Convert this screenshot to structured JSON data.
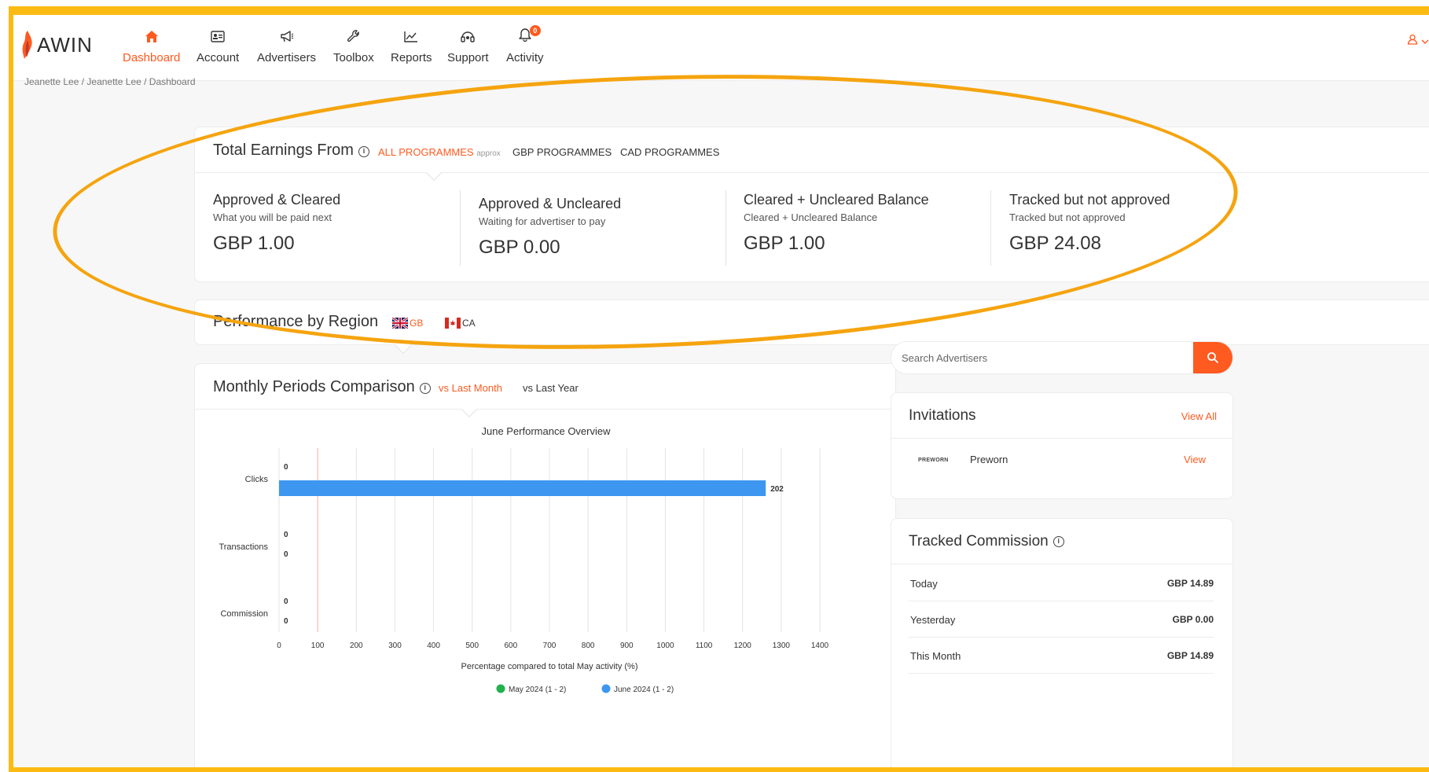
{
  "app": {
    "logo_text": "AWIN"
  },
  "nav": {
    "items": [
      {
        "label": "Dashboard",
        "icon": "home-icon"
      },
      {
        "label": "Account",
        "icon": "id-card-icon"
      },
      {
        "label": "Advertisers",
        "icon": "megaphone-icon"
      },
      {
        "label": "Toolbox",
        "icon": "wrench-icon"
      },
      {
        "label": "Reports",
        "icon": "chart-line-icon"
      },
      {
        "label": "Support",
        "icon": "headset-icon"
      },
      {
        "label": "Activity",
        "icon": "bell-icon"
      }
    ],
    "activity_badge": "0",
    "accent_color": "#ff5a1f"
  },
  "breadcrumb": "Jeanette Lee / Jeanette Lee / Dashboard",
  "earnings": {
    "title": "Total Earnings From",
    "tabs": {
      "all": "ALL PROGRAMMES",
      "all_note": "approx",
      "gbp": "GBP PROGRAMMES",
      "cad": "CAD PROGRAMMES"
    },
    "cols": [
      {
        "label": "Approved & Cleared",
        "sub": "What you will be paid next",
        "amount": "GBP 1.00"
      },
      {
        "label": "Approved & Uncleared",
        "sub": "Waiting for advertiser to pay",
        "amount": "GBP 0.00"
      },
      {
        "label": "Cleared + Uncleared Balance",
        "sub": "Cleared + Uncleared Balance",
        "amount": "GBP 1.00"
      },
      {
        "label": "Tracked but not approved",
        "sub": "Tracked but not approved",
        "amount": "GBP 24.08"
      }
    ]
  },
  "region": {
    "title": "Performance by Region",
    "gb": "GB",
    "ca": "CA"
  },
  "monthly": {
    "title": "Monthly Periods Comparison",
    "tab_last_month": "vs Last Month",
    "tab_last_year": "vs Last Year"
  },
  "chart_data": {
    "type": "bar",
    "orientation": "horizontal",
    "title": "June Performance Overview",
    "xlabel": "Percentage compared to total May activity (%)",
    "categories": [
      "Clicks",
      "Transactions",
      "Commission"
    ],
    "series": [
      {
        "name": "May 2024 (1 - 2)",
        "color": "#22b14c",
        "values": [
          0,
          0,
          0
        ]
      },
      {
        "name": "June 2024 (1 - 2)",
        "color": "#3d97f0",
        "values": [
          202,
          0,
          0
        ]
      }
    ],
    "bar_extent_percent": 1260,
    "xlim": [
      0,
      1400
    ],
    "xticks": [
      0,
      100,
      200,
      300,
      400,
      500,
      600,
      700,
      800,
      900,
      1000,
      1100,
      1200,
      1300,
      1400
    ],
    "reference_line": 100,
    "grid": true,
    "legend": "bottom"
  },
  "search": {
    "placeholder": "Search Advertisers"
  },
  "invitations": {
    "title": "Invitations",
    "view_all": "View All",
    "items": [
      {
        "logo": "PREWORN",
        "name": "Preworn",
        "action": "View"
      }
    ]
  },
  "tracked": {
    "title": "Tracked Commission",
    "rows": [
      {
        "label": "Today",
        "value": "GBP 14.89"
      },
      {
        "label": "Yesterday",
        "value": "GBP 0.00"
      },
      {
        "label": "This Month",
        "value": "GBP 14.89"
      }
    ]
  }
}
